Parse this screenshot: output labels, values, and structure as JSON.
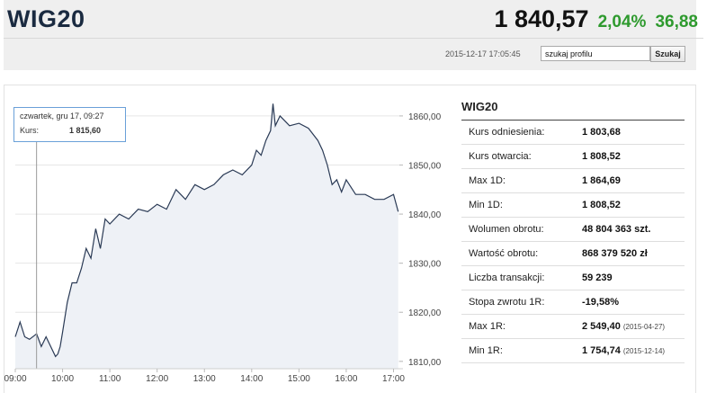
{
  "header": {
    "index_name": "WIG20",
    "value": "1 840,57",
    "change_pct": "2,04%",
    "change_abs": "36,88",
    "timestamp": "2015-12-17 17:05:45",
    "search_value": "szukaj profilu",
    "search_button": "Szukaj"
  },
  "colors": {
    "positive": "#2e9a2e",
    "line": "#2a3a55",
    "area": "#eef1f6",
    "tooltip_border": "#6aa0d8"
  },
  "tooltip": {
    "date": "czwartek, gru 17, 09:27",
    "label": "Kurs:",
    "value": "1 815,60"
  },
  "stats": {
    "title": "WIG20",
    "rows": [
      {
        "label": "Kurs odniesienia:",
        "value": "1 803,68",
        "note": ""
      },
      {
        "label": "Kurs otwarcia:",
        "value": "1 808,52",
        "note": ""
      },
      {
        "label": "Max 1D:",
        "value": "1 864,69",
        "note": ""
      },
      {
        "label": "Min 1D:",
        "value": "1 808,52",
        "note": ""
      },
      {
        "label": "Wolumen obrotu:",
        "value": "48 804 363 szt.",
        "note": ""
      },
      {
        "label": "Wartość obrotu:",
        "value": "868 379 520 zł",
        "note": ""
      },
      {
        "label": "Liczba transakcji:",
        "value": "59 239",
        "note": ""
      },
      {
        "label": "Stopa zwrotu 1R:",
        "value": "-19,58%",
        "note": ""
      },
      {
        "label": "Max 1R:",
        "value": "2 549,40",
        "note": "(2015-04-27)"
      },
      {
        "label": "Min 1R:",
        "value": "1 754,74",
        "note": "(2015-12-14)"
      }
    ]
  },
  "chart_data": {
    "type": "area",
    "x_tick_labels": [
      "09:00",
      "10:00",
      "11:00",
      "12:00",
      "13:00",
      "14:00",
      "15:00",
      "16:00",
      "17:00"
    ],
    "y_tick_labels": [
      "1860,00",
      "1850,00",
      "1840,00",
      "1830,00",
      "1820,00",
      "1810,00"
    ],
    "y_ticks": [
      1860,
      1850,
      1840,
      1830,
      1820,
      1810
    ],
    "xlim": [
      9.0,
      17.2
    ],
    "ylim": [
      1808.5,
      1862
    ],
    "crosshair_x": 9.45,
    "grid": "horizontal",
    "series": [
      {
        "x": [
          9.0,
          9.1,
          9.2,
          9.3,
          9.45,
          9.55,
          9.65,
          9.75,
          9.85,
          9.9,
          9.95,
          10.0,
          10.1,
          10.2,
          10.3,
          10.4,
          10.5,
          10.6,
          10.7,
          10.8,
          10.9,
          11.0,
          11.2,
          11.4,
          11.6,
          11.8,
          12.0,
          12.2,
          12.4,
          12.6,
          12.8,
          13.0,
          13.2,
          13.4,
          13.6,
          13.8,
          14.0,
          14.1,
          14.2,
          14.3,
          14.4,
          14.45,
          14.5,
          14.6,
          14.8,
          15.0,
          15.2,
          15.4,
          15.5,
          15.6,
          15.7,
          15.8,
          15.9,
          16.0,
          16.2,
          16.4,
          16.6,
          16.8,
          17.0,
          17.1
        ],
        "y": [
          1815,
          1818,
          1815,
          1814.5,
          1815.6,
          1813,
          1815,
          1813,
          1811,
          1811.5,
          1813,
          1816,
          1822,
          1826,
          1826,
          1829,
          1833,
          1831,
          1837,
          1833,
          1839,
          1838,
          1840,
          1839,
          1841,
          1840.5,
          1842,
          1841,
          1845,
          1843,
          1846,
          1845,
          1846,
          1848,
          1849,
          1848,
          1850,
          1853,
          1852,
          1855,
          1857,
          1862.5,
          1858,
          1860,
          1858,
          1858.5,
          1857.5,
          1855,
          1853,
          1850,
          1846,
          1847,
          1844.5,
          1847,
          1844,
          1844,
          1843,
          1843,
          1844,
          1840.5
        ]
      }
    ]
  }
}
